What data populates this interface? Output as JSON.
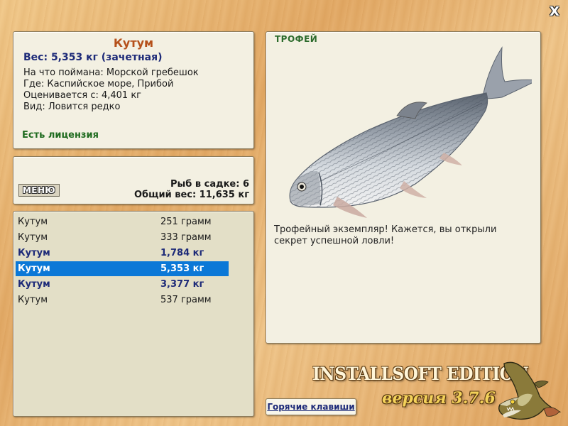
{
  "window": {
    "close_label": "X"
  },
  "info": {
    "fish_name": "Кутум",
    "weight_line": "Вес: 5,353 кг (зачетная)",
    "bait_line": "На что поймана: Морской гребешок",
    "location_line": "Где: Каспийское море, Прибой",
    "rated_line": "Оценивается с: 4,401 кг",
    "kind_line": "Вид: Ловится редко",
    "license": "Есть лицензия"
  },
  "menu": {
    "button_label": "МЕНЮ",
    "fish_count": "Рыб в садке: 6",
    "total_weight": "Общий вес: 11,635 кг"
  },
  "catch_list": [
    {
      "name": "Кутум",
      "weight": "251 грамм",
      "trophy": false,
      "selected": false
    },
    {
      "name": "Кутум",
      "weight": "333 грамм",
      "trophy": false,
      "selected": false
    },
    {
      "name": "Кутум",
      "weight": "1,784 кг",
      "trophy": true,
      "selected": false
    },
    {
      "name": "Кутум",
      "weight": "5,353 кг",
      "trophy": true,
      "selected": true
    },
    {
      "name": "Кутум",
      "weight": "3,377 кг",
      "trophy": true,
      "selected": false
    },
    {
      "name": "Кутум",
      "weight": "537 грамм",
      "trophy": false,
      "selected": false
    }
  ],
  "trophy": {
    "title": "ТРОФЕЙ",
    "image": "kutum-fish-image",
    "description": "Трофейный экземпляр! Кажется, вы открыли секрет успешной ловли!"
  },
  "hotkeys_label": "Горячие клавиши",
  "brand": {
    "edition": "INSTALLSOFT EDITION",
    "version": "версия 3.7.6",
    "logo": "pike-logo-icon"
  },
  "colors": {
    "fish_name": "#b5501a",
    "weight": "#1d2a78",
    "license": "#1f6b1f",
    "trophy_title": "#2b6a2b",
    "selection": "#0b78d7"
  }
}
